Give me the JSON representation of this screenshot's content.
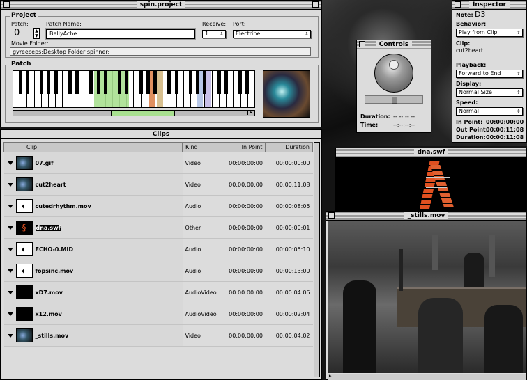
{
  "project": {
    "title": "spin.project",
    "section_project": "Project",
    "patch_label": "Patch:",
    "patch_value": "0",
    "patch_name_label": "Patch Name:",
    "patch_name_value": "BellyAche",
    "receive_label": "Receive:",
    "receive_value": "1",
    "port_label": "Port:",
    "port_value": "Electribe",
    "movie_folder_label": "Movie Folder:",
    "movie_folder_value": "gyreeceps:Desktop Folder:spinner:",
    "section_patch": "Patch"
  },
  "clips": {
    "title": "Clips",
    "columns": [
      "Clip",
      "Kind",
      "In Point",
      "Duration"
    ],
    "rows": [
      {
        "name": "07.gif",
        "kind": "Video",
        "in": "00:00:00:00",
        "dur": "00:00:00:00",
        "icon": "video-thumb"
      },
      {
        "name": "cut2heart",
        "kind": "Video",
        "in": "00:00:00:00",
        "dur": "00:00:11:08",
        "icon": "video-thumb"
      },
      {
        "name": "cutedrhythm.mov",
        "kind": "Audio",
        "in": "00:00:00:00",
        "dur": "00:00:08:05",
        "icon": "speaker-icon"
      },
      {
        "name": "dna.swf",
        "kind": "Other",
        "in": "00:00:00:00",
        "dur": "00:00:00:01",
        "icon": "dna-thumb"
      },
      {
        "name": "ECHO-0.MID",
        "kind": "Audio",
        "in": "00:00:00:00",
        "dur": "00:00:05:10",
        "icon": "speaker-icon"
      },
      {
        "name": "fopsinc.mov",
        "kind": "Audio",
        "in": "00:00:00:00",
        "dur": "00:00:13:00",
        "icon": "speaker-icon"
      },
      {
        "name": "xD7.mov",
        "kind": "AudioVideo",
        "in": "00:00:00:00",
        "dur": "00:00:04:06",
        "icon": "black-thumb"
      },
      {
        "name": "x12.mov",
        "kind": "AudioVideo",
        "in": "00:00:00:00",
        "dur": "00:00:02:04",
        "icon": "black-thumb"
      },
      {
        "name": "_stills.mov",
        "kind": "Video",
        "in": "00:00:00:00",
        "dur": "00:00:04:02",
        "icon": "video-thumb"
      }
    ]
  },
  "controls": {
    "title": "Controls",
    "duration_label": "Duration:",
    "duration_value": "--:--:--:--",
    "time_label": "Time:",
    "time_value": "--:--:--:--"
  },
  "inspector": {
    "title": "Inspector",
    "note_label": "Note:",
    "note_value": "D3",
    "behavior_label": "Behavior:",
    "behavior_value": "Play from Clip",
    "clip_label": "Clip:",
    "clip_value": "cut2heart",
    "playback_label": "Playback:",
    "playback_value": "Forward to End",
    "display_label": "Display:",
    "display_value": "Normal Size",
    "speed_label": "Speed:",
    "speed_value": "Normal",
    "in_point_label": "In Point:",
    "in_point_value": "00:00:00:00",
    "out_point_label": "Out Point:",
    "out_point_value": "00:00:11:08",
    "duration_label": "Duration:",
    "duration_value": "00:00:11:08"
  },
  "dna_window": {
    "title": "dna.swf"
  },
  "stills_window": {
    "title": "_stills.mov"
  },
  "colors": {
    "highlight_green": "#a8e090",
    "selected_row": "#000000",
    "window_bg": "#dcdcdc"
  }
}
